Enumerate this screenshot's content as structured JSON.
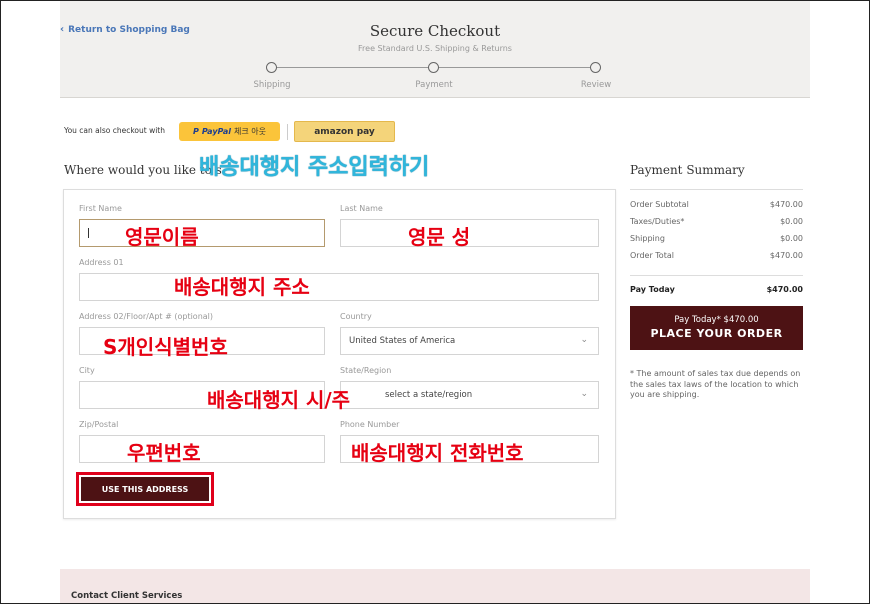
{
  "header": {
    "back_link": "Return to Shopping Bag",
    "title": "Secure Checkout",
    "subtitle": "Free Standard U.S. Shipping & Returns",
    "steps": [
      {
        "label": "Shipping",
        "active": true
      },
      {
        "label": "Payment",
        "active": false
      },
      {
        "label": "Review",
        "active": false
      }
    ]
  },
  "alt_checkout": {
    "text": "You can also checkout with",
    "paypal_brand": "PayPal",
    "paypal_cta": "체크 아웃",
    "amazon_label": "amazon pay"
  },
  "shipping_form": {
    "heading": "Where would you like to s",
    "fields": {
      "first_name": {
        "label": "First Name",
        "value": ""
      },
      "last_name": {
        "label": "Last Name",
        "value": ""
      },
      "address1": {
        "label": "Address 01",
        "value": ""
      },
      "address2": {
        "label": "Address 02/Floor/Apt # (optional)",
        "value": ""
      },
      "country": {
        "label": "Country",
        "value": "United States of America"
      },
      "city": {
        "label": "City",
        "value": ""
      },
      "state": {
        "label": "State/Region",
        "value": "select a state/region"
      },
      "zip": {
        "label": "Zip/Postal",
        "value": ""
      },
      "phone": {
        "label": "Phone Number",
        "value": ""
      }
    },
    "use_address_button": "USE THIS ADDRESS"
  },
  "annotations": {
    "heading_note": "배송대행지 주소입력하기",
    "first_name_note": "영문이름",
    "last_name_note": "영문 성",
    "address1_note": "배송대행지 주소",
    "address2_note": "S개인식별번호",
    "city_state_note": "배송대행지 시/주",
    "zip_note": "우편번호",
    "phone_note": "배송대행지 전화번호"
  },
  "summary": {
    "title": "Payment Summary",
    "rows": [
      {
        "label": "Order Subtotal",
        "value": "$470.00"
      },
      {
        "label": "Taxes/Duties*",
        "value": "$0.00"
      },
      {
        "label": "Shipping",
        "value": "$0.00"
      },
      {
        "label": "Order Total",
        "value": "$470.00"
      }
    ],
    "pay_today_label": "Pay Today",
    "pay_today_value": "$470.00",
    "place_order_sub": "Pay Today* $470.00",
    "place_order_main": "PLACE YOUR ORDER",
    "tax_note": "* The amount of sales tax due depends on the sales tax laws of the location to which you are shipping."
  },
  "footer": {
    "contact": "Contact Client Services"
  },
  "colors": {
    "accent_dark": "#4d1214",
    "link_blue": "#4a77b8",
    "annotation_red": "#e60012",
    "annotation_cyan": "#2fb6dc",
    "paypal_yellow": "#fbc43a"
  }
}
